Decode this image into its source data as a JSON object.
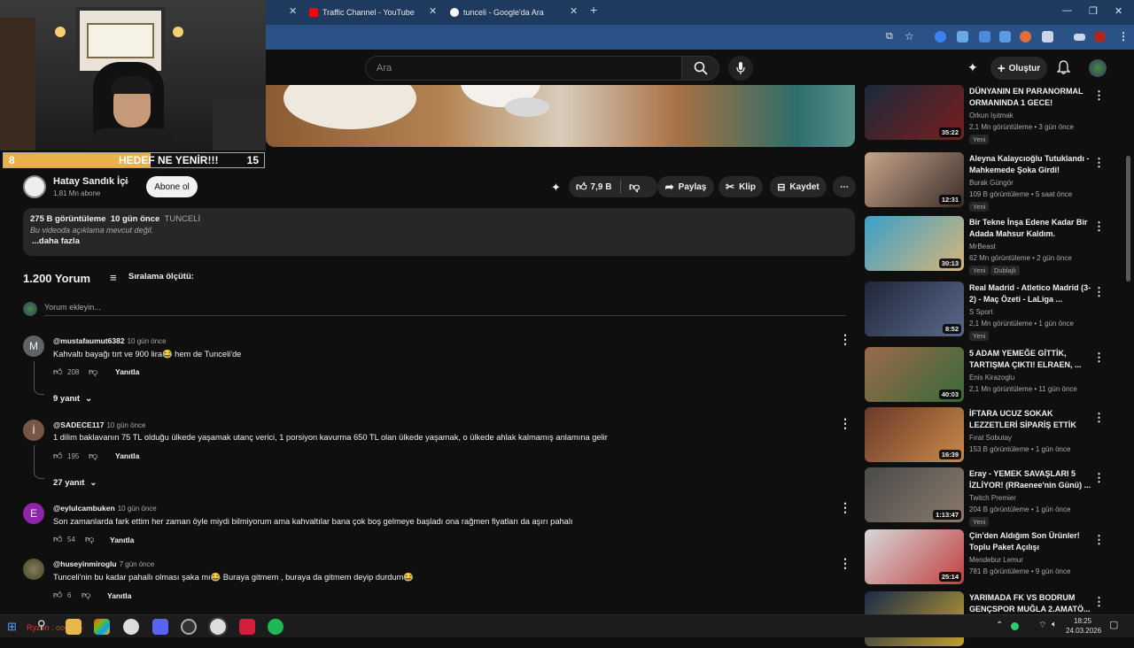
{
  "browser": {
    "tabs": [
      {
        "label": "Traffic Channel - YouTube"
      },
      {
        "label": "tunceli - Google'da Ara"
      }
    ]
  },
  "header": {
    "search_placeholder": "Ara",
    "create_label": "Oluştur"
  },
  "webcam": {
    "ticker_left": "8",
    "ticker_text": "HEDEF NE YENİR!!!",
    "ticker_right": "15"
  },
  "channel": {
    "name": "Hatay Sandık İçi",
    "subs": "1,81 Mn abone",
    "subscribe_label": "Abone ol"
  },
  "actions": {
    "likes": "7,9 B",
    "share": "Paylaş",
    "clip": "Klip",
    "save": "Kaydet"
  },
  "description": {
    "views": "275 B görüntüleme",
    "date": "10 gün önce",
    "tag": "TUNCELİ",
    "empty": "Bu videoda açıklama mevcut değil.",
    "more": "...daha fazla"
  },
  "comments": {
    "count_label": "1.200 Yorum",
    "sort_label": "Sıralama ölçütü:",
    "add_placeholder": "Yorum ekleyin...",
    "reply_label": "Yanıtla",
    "items": [
      {
        "user": "@mustafaumut6382",
        "time": "10 gün önce",
        "text": "Kahvaltı bayağı tırt ve 900 lira😂 hem de Tunceli'de",
        "likes": "208",
        "replies": "9 yanıt",
        "avatar": "M",
        "color": "#5f6368"
      },
      {
        "user": "@SADECE117",
        "time": "10 gün önce",
        "text": "1 dilim baklavanın 75 TL olduğu ülkede yaşamak utanç verici, 1 porsiyon kavurma 650 TL olan ülkede yaşamak, o ülkede ahlak kalmamış anlamına gelir",
        "likes": "195",
        "replies": "27 yanıt",
        "avatar": "İ",
        "color": "#795548"
      },
      {
        "user": "@eylulcambuken",
        "time": "10 gün önce",
        "text": "Son zamanlarda fark ettim her zaman öyle miydi bilmiyorum ama kahvaltılar bana çok boş gelmeye başladı ona rağmen fiyatları da aşırı pahalı",
        "likes": "54",
        "replies": "",
        "avatar": "E",
        "color": "#8e24aa"
      },
      {
        "user": "@huseyinmiroglu",
        "time": "7 gün önce",
        "text": "Tunceli'nin bu kadar pahallı olması şaka mı😂 Buraya gitmem , buraya da gitmem deyip durdum😂",
        "likes": "6",
        "replies": "",
        "avatar": "",
        "color": "#4e5b31"
      }
    ]
  },
  "recommendations": [
    {
      "title": "DÜNYANIN EN PARANORMAL ORMANINDA 1 GECE!",
      "channel": "Orkun Işıtmak",
      "meta": "2,1 Mn görüntüleme • 3 gün önce",
      "duration": "35:22",
      "badge": "Yeni",
      "badge2": "",
      "c1": "#1b2a3a",
      "c2": "#7a1d1d"
    },
    {
      "title": "Aleyna Kalaycıoğlu Tutuklandı - Mahkemede Şoka Girdi!",
      "channel": "Burak Güngör",
      "meta": "109 B görüntüleme • 5 saat önce",
      "duration": "12:31",
      "badge": "Yeni",
      "badge2": "",
      "c1": "#c9a48a",
      "c2": "#3a2f2a"
    },
    {
      "title": "Bir Tekne İnşa Edene Kadar Bir Adada Mahsur Kaldım.",
      "channel": "MrBeast",
      "meta": "62 Mn görüntüleme • 2 gün önce",
      "duration": "30:13",
      "badge": "Yeni",
      "badge2": "Dublajlı",
      "c1": "#3aa0c8",
      "c2": "#d7b57a"
    },
    {
      "title": "Real Madrid - Atletico Madrid (3-2) - Maç Özeti - LaLiga ...",
      "channel": "S Sport",
      "meta": "2,1 Mn görüntüleme • 1 gün önce",
      "duration": "8:52",
      "badge": "Yeni",
      "badge2": "",
      "c1": "#20263a",
      "c2": "#5a6a8a"
    },
    {
      "title": "5 ADAM YEMEĞE GİTTİK, TARTIŞMA ÇIKTI! ELRAEN, ...",
      "channel": "Enis Kirazoglu",
      "meta": "2,1 Mn görüntüleme • 11 gün önce",
      "duration": "40:03",
      "badge": "",
      "badge2": "",
      "c1": "#9a6a4a",
      "c2": "#3a6a3a"
    },
    {
      "title": "İFTARA UCUZ SOKAK LEZZETLERİ SİPARİŞ ETTİK",
      "channel": "Fırat Sobutay",
      "meta": "153 B görüntüleme • 1 gün önce",
      "duration": "16:39",
      "badge": "",
      "badge2": "",
      "c1": "#6a3a2a",
      "c2": "#c98a4a"
    },
    {
      "title": "Eray - YEMEK SAVAŞLARI 5 İZLİYOR! (RRaenee'nin Günü) ...",
      "channel": "Twitch Premier",
      "meta": "204 B görüntüleme • 1 gün önce",
      "duration": "1:13:47",
      "badge": "Yeni",
      "badge2": "",
      "c1": "#4a4a4a",
      "c2": "#8a7a6a"
    },
    {
      "title": "Çin'den Aldığım Son Ürünler! Toplu Paket Açılışı",
      "channel": "Mendebur Lemur",
      "meta": "781 B görüntüleme • 9 gün önce",
      "duration": "25:14",
      "badge": "",
      "badge2": "",
      "c1": "#d8d8d8",
      "c2": "#c04040"
    },
    {
      "title": "YARIMADA FK VS BODRUM GENÇSPOR MUĞLA 2.AMATÖ...",
      "channel": "",
      "meta": "",
      "duration": "",
      "badge": "",
      "badge2": "",
      "c1": "#1a2a4a",
      "c2": "#c0a030"
    }
  ],
  "taskbar": {
    "left_text": "Ryzen : oooooo",
    "time": "18:25",
    "date": "24.03.2026"
  }
}
